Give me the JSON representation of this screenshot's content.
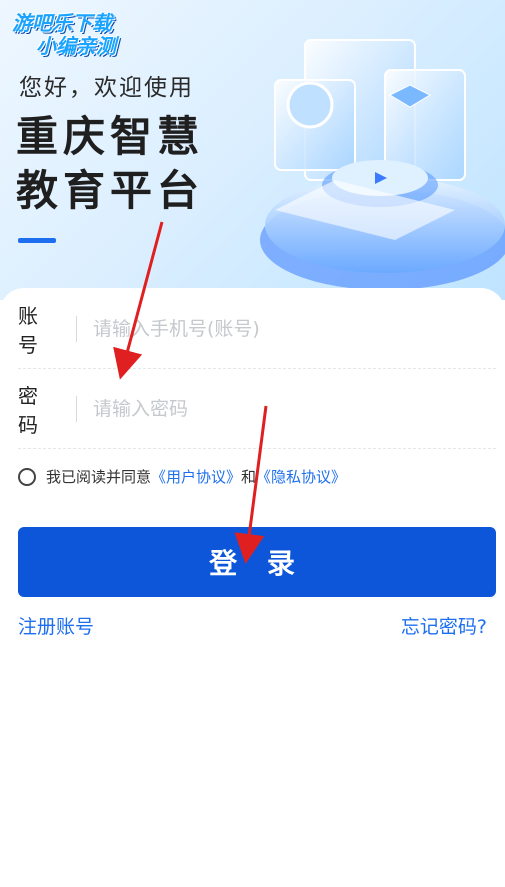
{
  "watermark": {
    "line1": "游吧乐下载",
    "line2": "小编亲测"
  },
  "hero": {
    "greeting": "您好，欢迎使用",
    "platform_name": "重庆智慧教育平台"
  },
  "form": {
    "account_label": "账 号",
    "account_placeholder": "请输入手机号(账号)",
    "password_label": "密 码",
    "password_placeholder": "请输入密码",
    "agreement_prefix": "我已阅读并同意",
    "user_agreement": "《用户协议》",
    "agreement_and": "和",
    "privacy_agreement": "《隐私协议》",
    "login_label": "登 录",
    "register_label": "注册账号",
    "forgot_label": "忘记密码?"
  },
  "colors": {
    "accent": "#1e6ff0",
    "button": "#0d56d9",
    "arrow": "#e02020"
  }
}
